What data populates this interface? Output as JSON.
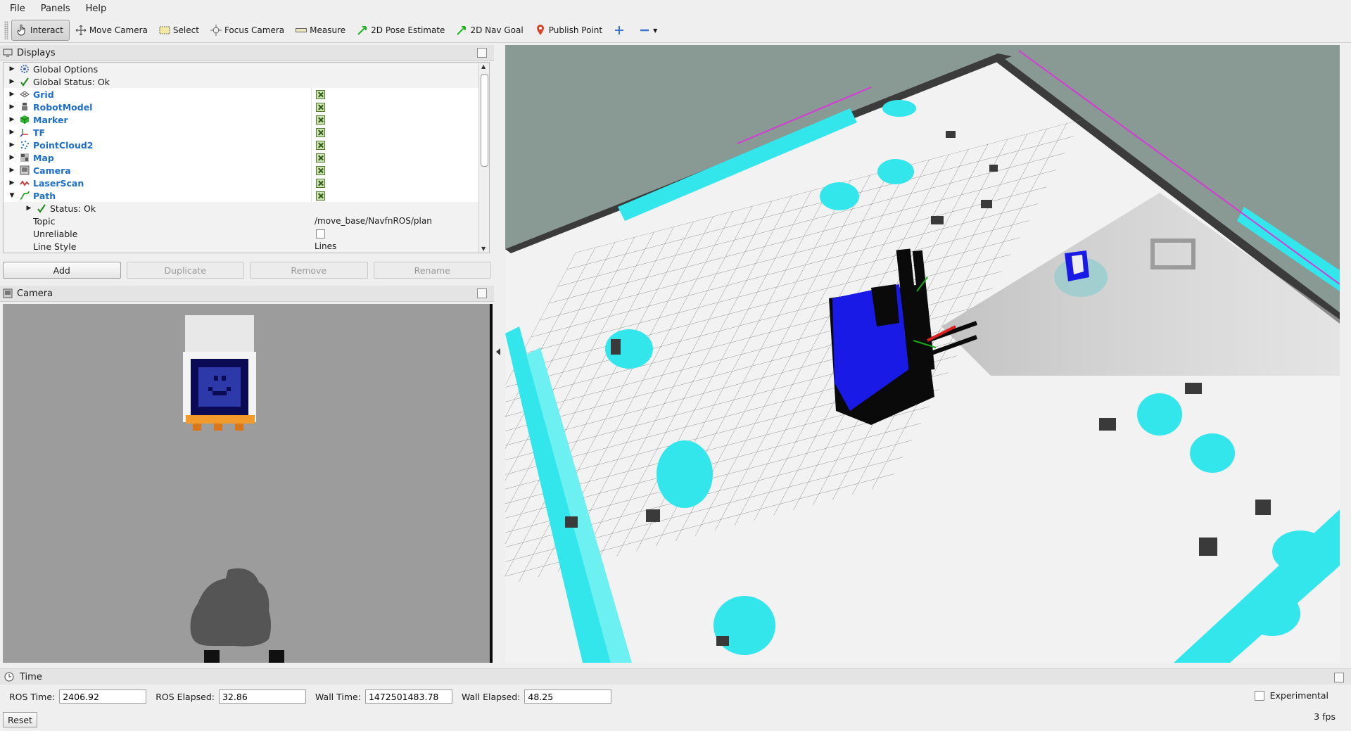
{
  "menu": {
    "file": "File",
    "panels": "Panels",
    "help": "Help"
  },
  "toolbar": {
    "interact": "Interact",
    "move_camera": "Move Camera",
    "select": "Select",
    "focus_camera": "Focus Camera",
    "measure": "Measure",
    "pose_estimate": "2D Pose Estimate",
    "nav_goal": "2D Nav Goal",
    "publish_point": "Publish Point"
  },
  "displays": {
    "title": "Displays",
    "global_options": "Global Options",
    "global_status": "Global Status: Ok",
    "items": [
      "Grid",
      "RobotModel",
      "Marker",
      "TF",
      "PointCloud2",
      "Map",
      "Camera",
      "LaserScan",
      "Path"
    ],
    "path_status": "Status: Ok",
    "topic_label": "Topic",
    "topic_value": "/move_base/NavfnROS/plan",
    "unreliable_label": "Unreliable",
    "line_style_label": "Line Style",
    "line_style_value": "Lines"
  },
  "buttons": {
    "add": "Add",
    "duplicate": "Duplicate",
    "remove": "Remove",
    "rename": "Rename"
  },
  "camera": {
    "title": "Camera"
  },
  "time": {
    "title": "Time",
    "ros_time_label": "ROS Time:",
    "ros_time": "2406.92",
    "ros_elapsed_label": "ROS Elapsed:",
    "ros_elapsed": "32.86",
    "wall_time_label": "Wall Time:",
    "wall_time": "1472501483.78",
    "wall_elapsed_label": "Wall Elapsed:",
    "wall_elapsed": "48.25",
    "experimental": "Experimental",
    "reset": "Reset",
    "fps": "3 fps"
  },
  "colors": {
    "accent_blue": "#1e6fc9",
    "inflation_cyan": "#33e6ec",
    "robot_blue": "#1a1ae6",
    "background_view": "#899994"
  }
}
